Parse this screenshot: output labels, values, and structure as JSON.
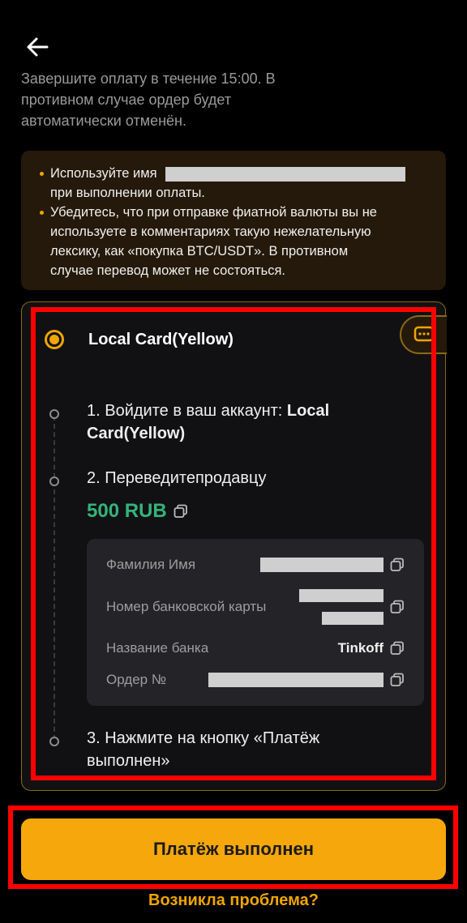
{
  "header": {
    "back_icon": "arrow-left-icon"
  },
  "intro": {
    "line1": "Завершите оплату в течение 15:00. В",
    "line2": "противном случае ордер будет",
    "line3": "автоматически отменён."
  },
  "notice": {
    "item1_prefix": "Используйте имя",
    "item1_suffix": "при выполнении оплаты.",
    "item2_line1": "Убедитесь, что при отправке фиатной валюты вы не",
    "item2_line2": "используете в комментариях такую нежелательную",
    "item2_line3": "лексику, как «покупка BTC/USDT». В противном",
    "item2_line4": "случае перевод может не состояться."
  },
  "payment": {
    "method_name": "Local Card(Yellow)",
    "step1_prefix": "1. Войдите в ваш аккаунт: ",
    "step1_account_a": "Local",
    "step1_account_b": "Card(Yellow)",
    "step2": "2. Переведитепродавцу",
    "amount": "500 RUB",
    "step3_line1": "3. Нажмите на кнопку «Платёж",
    "step3_line2": "выполнен»",
    "details": [
      {
        "label": "Фамилия Имя"
      },
      {
        "label": "Номер банковской карты"
      },
      {
        "label": "Название банка",
        "value": "Tinkoff"
      },
      {
        "label": "Ордер №"
      }
    ]
  },
  "actions": {
    "confirm_label": "Платёж выполнен",
    "problem_label": "Возникла проблема?"
  },
  "colors": {
    "accent": "#f5a70b",
    "success": "#35b37a",
    "highlight": "#ff0000"
  }
}
